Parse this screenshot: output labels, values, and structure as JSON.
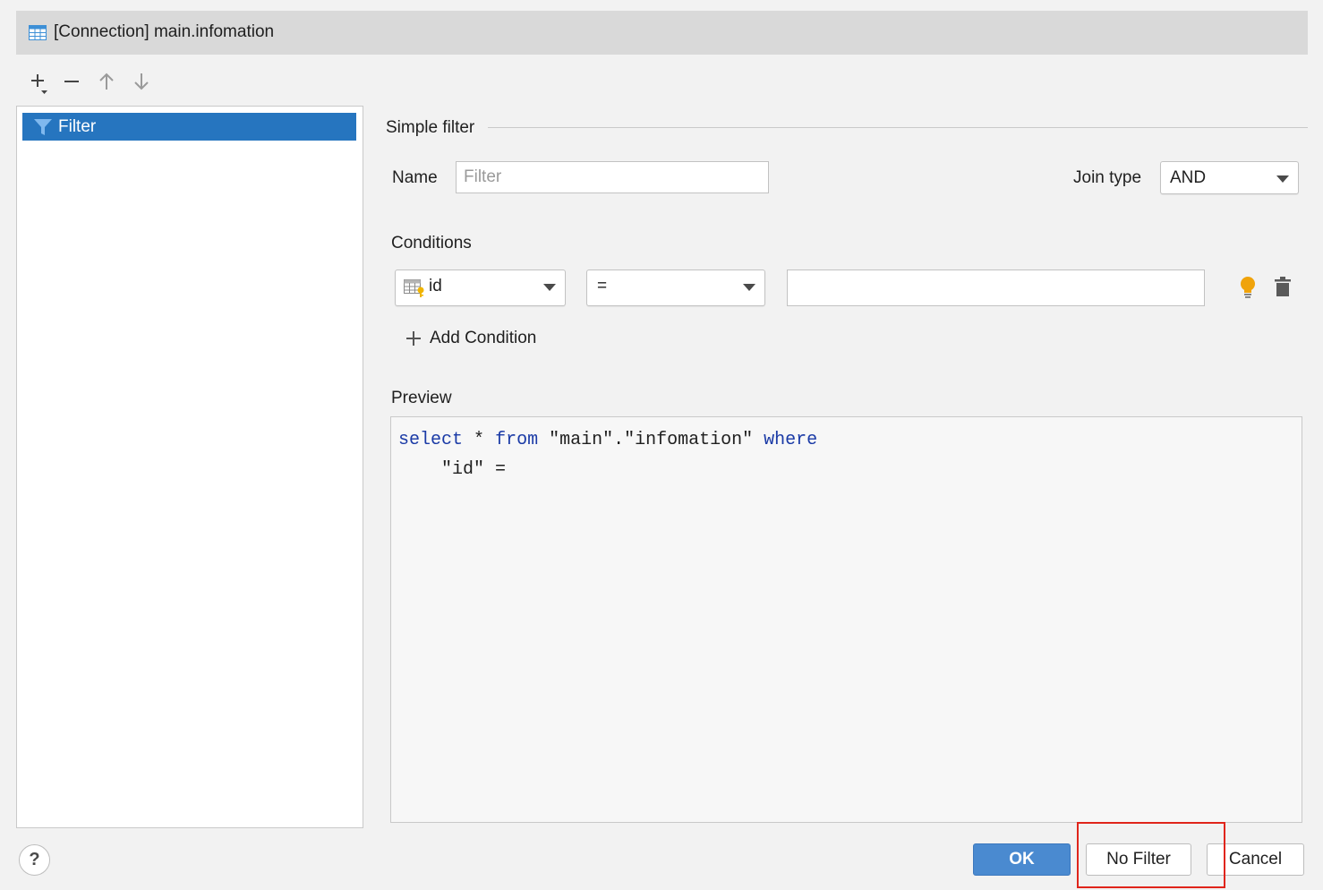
{
  "window": {
    "title": "[Connection] main.infomation",
    "icon": "table-icon"
  },
  "toolbar": {
    "icons": [
      "add-dropdown-icon",
      "remove-icon",
      "move-up-icon",
      "move-down-icon"
    ]
  },
  "filters_list": {
    "items": [
      {
        "label": "Filter",
        "icon": "funnel-icon",
        "selected": true
      }
    ]
  },
  "form": {
    "section_title": "Simple filter",
    "name_label": "Name",
    "name_value": "",
    "name_placeholder": "Filter",
    "join_type_label": "Join type",
    "join_type_value": "AND",
    "conditions_label": "Conditions",
    "condition": {
      "column": "id",
      "column_icon": "table-key-icon",
      "operator": "=",
      "value": ""
    },
    "add_condition_label": "Add Condition",
    "preview_label": "Preview",
    "preview": {
      "kw_select": "select",
      "star": "*",
      "kw_from": "from",
      "table_ref": "\"main\".\"infomation\"",
      "kw_where": "where",
      "line2": "\"id\" ="
    }
  },
  "buttons": {
    "help": "?",
    "ok": "OK",
    "no_filter": "No Filter",
    "cancel": "Cancel"
  },
  "colors": {
    "selection": "#2675bf",
    "ok_button": "#4a8ad0",
    "keyword": "#1a3aa6",
    "highlight_box": "#e0251b",
    "bulb": "#f0a30a"
  }
}
